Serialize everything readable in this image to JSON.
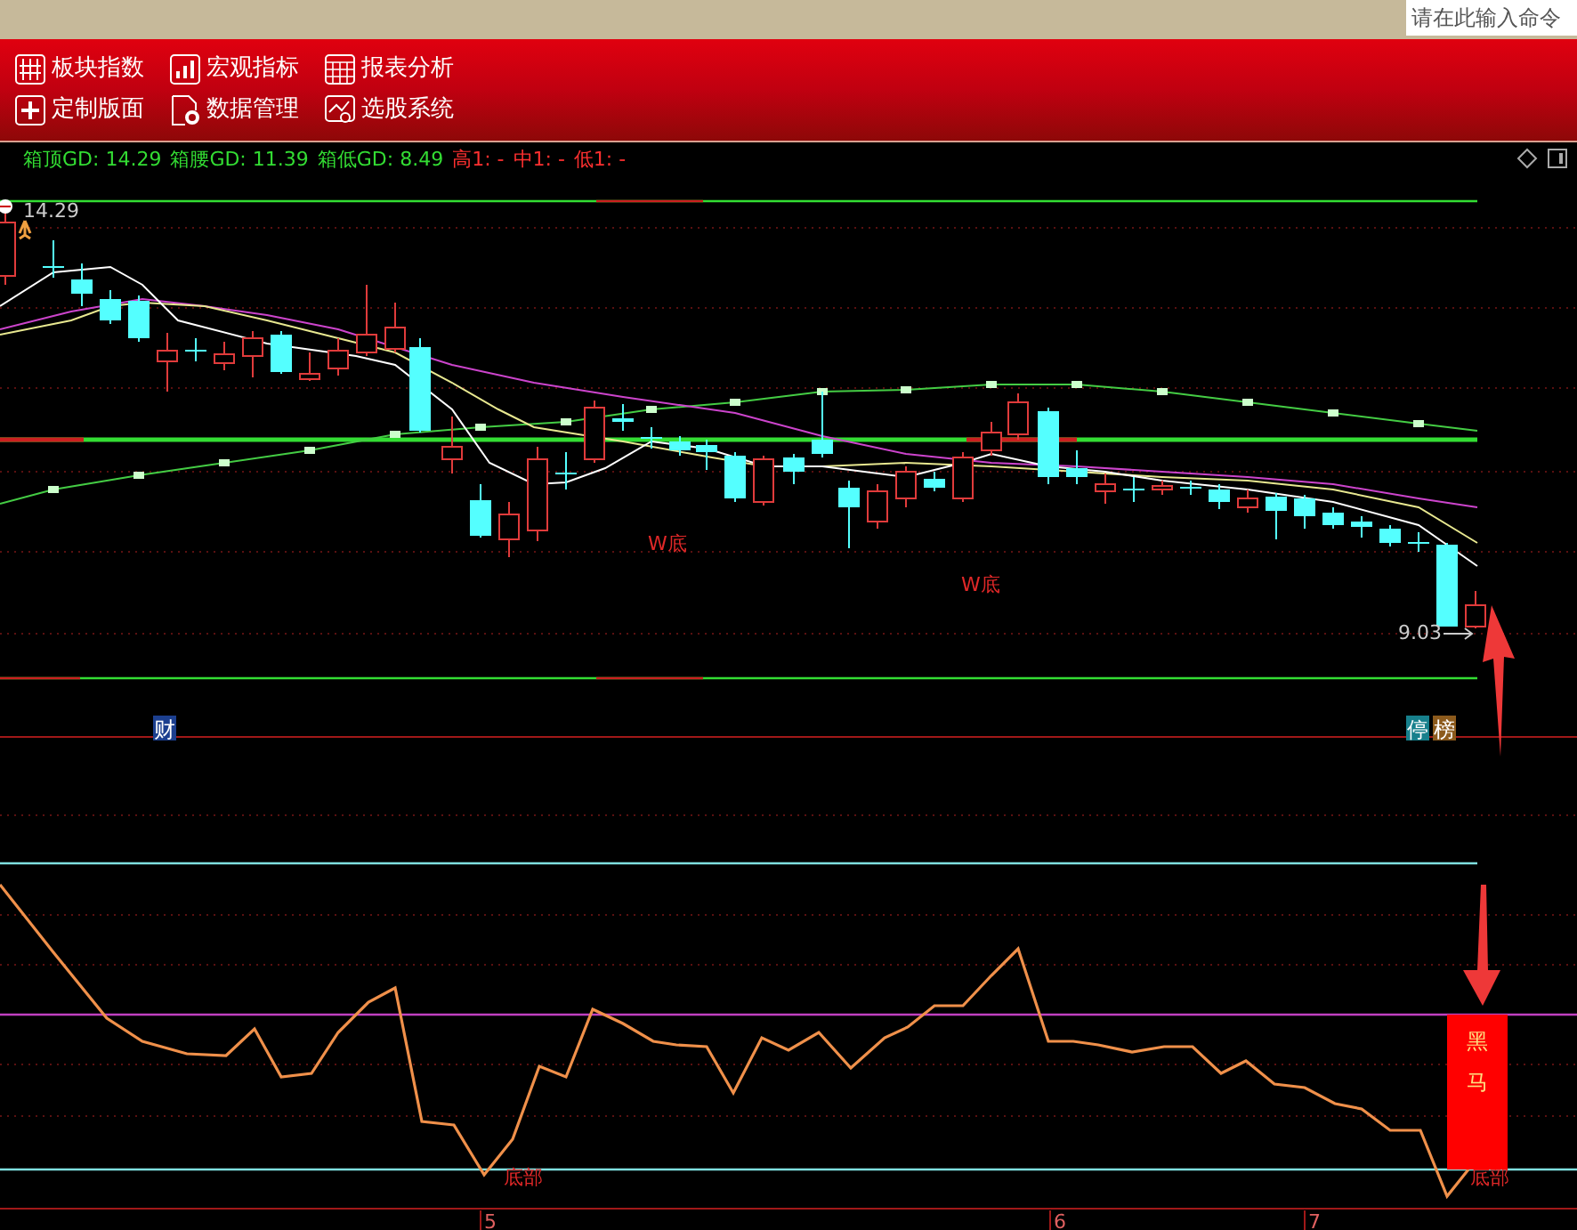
{
  "command_box": {
    "placeholder": "请在此输入命令"
  },
  "toolbar": {
    "buttons": [
      {
        "label": "板块指数",
        "kind": "blocks"
      },
      {
        "label": "宏观指标",
        "kind": "bars"
      },
      {
        "label": "报表分析",
        "kind": "table"
      },
      {
        "label": "定制版面",
        "kind": "plus"
      },
      {
        "label": "数据管理",
        "kind": "gear"
      },
      {
        "label": "选股系统",
        "kind": "search"
      }
    ]
  },
  "legend": [
    {
      "text": "箱顶GD: 14.29",
      "color": "#33dd33"
    },
    {
      "text": "箱腰GD: 11.39",
      "color": "#33dd33"
    },
    {
      "text": "箱低GD: 8.49",
      "color": "#33dd33"
    },
    {
      "text": "高1: -",
      "color": "#ff3030"
    },
    {
      "text": "中1: -",
      "color": "#ff3030"
    },
    {
      "text": "低1: -",
      "color": "#ff3030"
    }
  ],
  "main_chart": {
    "price_labels": [
      "14.29",
      "9.03"
    ],
    "pattern_labels": [
      "W底",
      "W底"
    ]
  },
  "markers": [
    {
      "text": "财",
      "color": "#1c3f8f"
    },
    {
      "text": "停",
      "color": "#17808c"
    },
    {
      "text": "榜",
      "color": "#8c5a1c"
    }
  ],
  "indicator": {
    "labels": [
      "底部",
      "底部"
    ],
    "signal": "黑马"
  },
  "x_axis": [
    "5",
    "6",
    "7"
  ]
}
